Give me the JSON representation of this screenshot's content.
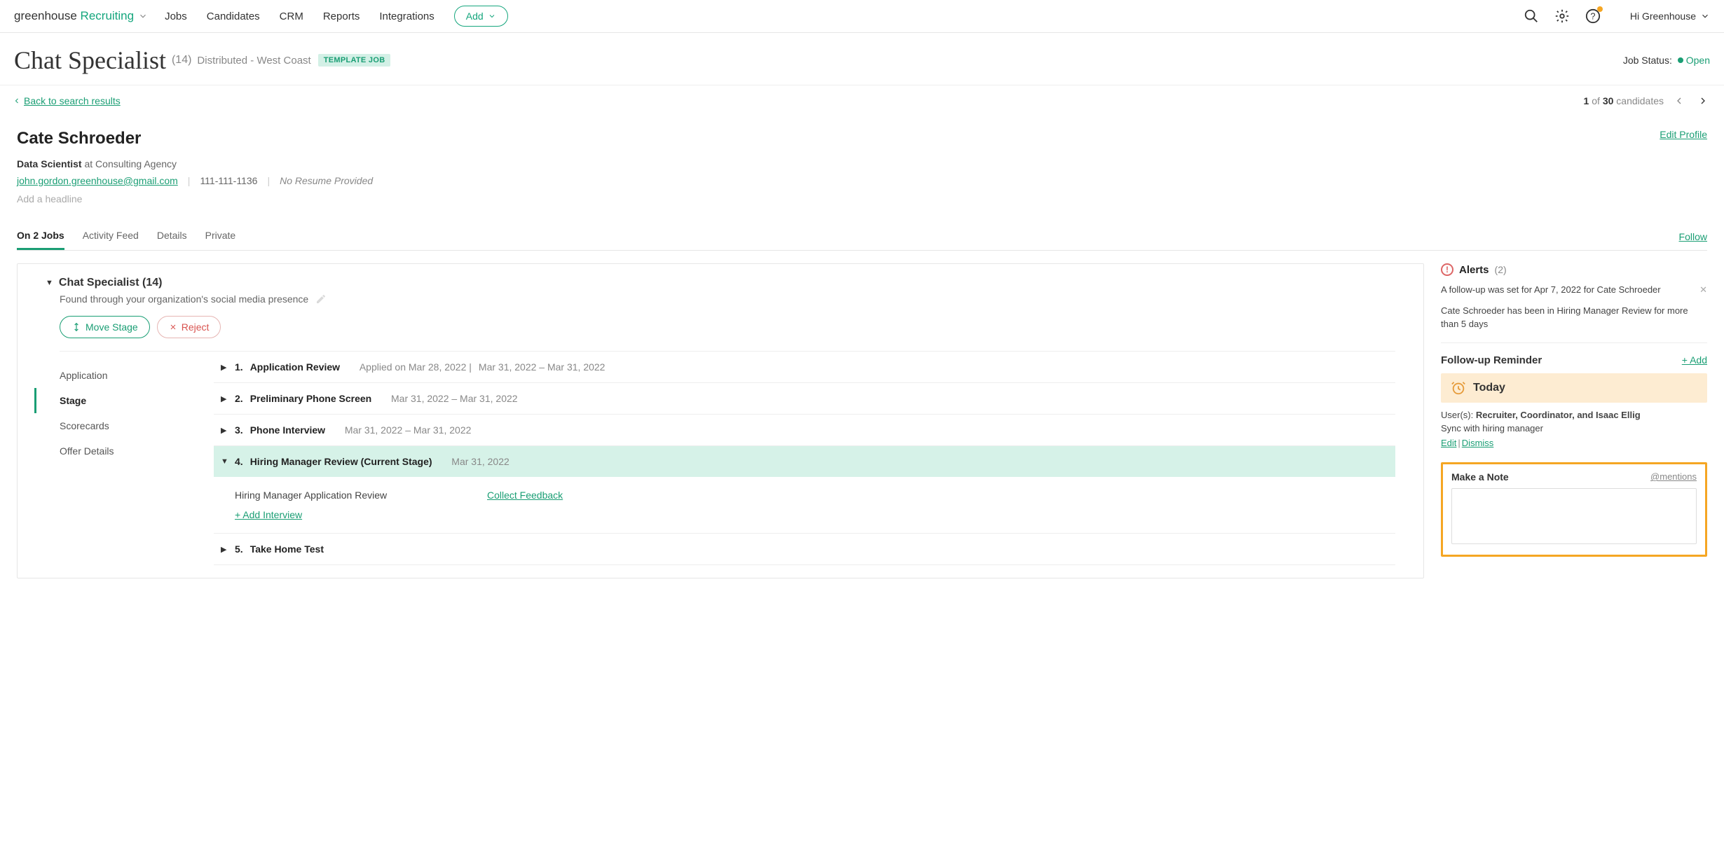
{
  "nav": {
    "logo_left": "greenhouse",
    "logo_right": "Recruiting",
    "links": [
      "Jobs",
      "Candidates",
      "CRM",
      "Reports",
      "Integrations"
    ],
    "add": "Add",
    "user": "Hi Greenhouse"
  },
  "job_header": {
    "title": "Chat Specialist",
    "count": "(14)",
    "location": "Distributed - West Coast",
    "template_badge": "TEMPLATE JOB",
    "status_label": "Job Status:",
    "status_value": "Open"
  },
  "back": {
    "label": "Back to search results"
  },
  "pager": {
    "current": "1",
    "of": "of",
    "total": "30",
    "suffix": "candidates"
  },
  "candidate": {
    "name": "Cate Schroeder",
    "edit_profile": "Edit Profile",
    "role_title": "Data Scientist",
    "role_at": " at Consulting Agency",
    "email": "john.gordon.greenhouse@gmail.com",
    "phone": "111-111-1136",
    "no_resume": "No Resume Provided",
    "add_headline": "Add a headline"
  },
  "tabs": {
    "items": [
      "On 2 Jobs",
      "Activity Feed",
      "Details",
      "Private"
    ],
    "follow": "Follow"
  },
  "left": {
    "job_title": "Chat Specialist (14)",
    "found_via": "Found through your organization's social media presence",
    "move_stage": "Move Stage",
    "reject": "Reject",
    "sidenav": [
      "Application",
      "Stage",
      "Scorecards",
      "Offer Details"
    ],
    "stages": [
      {
        "num": "1.",
        "name": "Application Review",
        "applied": "Applied on Mar 28, 2022 |",
        "dates": "Mar 31, 2022 – Mar 31, 2022"
      },
      {
        "num": "2.",
        "name": "Preliminary Phone Screen",
        "applied": "",
        "dates": "Mar 31, 2022 – Mar 31, 2022"
      },
      {
        "num": "3.",
        "name": "Phone Interview",
        "applied": "",
        "dates": "Mar 31, 2022 – Mar 31, 2022"
      },
      {
        "num": "4.",
        "name": "Hiring Manager Review (Current Stage)",
        "applied": "",
        "dates": "Mar 31, 2022"
      },
      {
        "num": "5.",
        "name": "Take Home Test",
        "applied": "",
        "dates": ""
      }
    ],
    "current_body": {
      "label": "Hiring Manager Application Review",
      "collect": "Collect Feedback",
      "add_interview": "+ Add Interview"
    }
  },
  "right": {
    "alerts_title": "Alerts",
    "alerts_count": "(2)",
    "alert1": "A follow-up was set for Apr 7, 2022 for Cate Schroeder",
    "alert2": "Cate Schroeder has been in Hiring Manager Review for more than 5 days",
    "followup_title": "Follow-up Reminder",
    "add_link": "+ Add",
    "today": "Today",
    "users_label": "User(s): ",
    "users": "Recruiter, Coordinator, and Isaac Ellig",
    "sync": "Sync with hiring manager",
    "edit": "Edit",
    "dismiss": "Dismiss",
    "note_title": "Make a Note",
    "mentions": "@mentions"
  }
}
